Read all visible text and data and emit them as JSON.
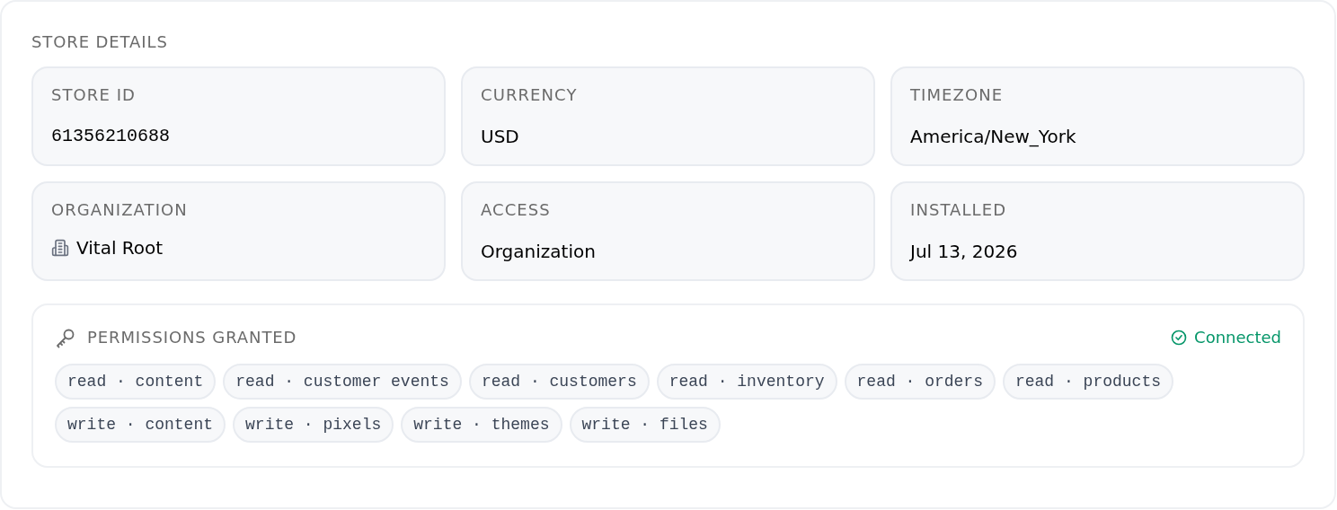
{
  "title": "STORE DETAILS",
  "fields": [
    {
      "label": "STORE ID",
      "value": "61356210688",
      "kind": "mono"
    },
    {
      "label": "CURRENCY",
      "value": "USD",
      "kind": "plain"
    },
    {
      "label": "TIMEZONE",
      "value": "America/New_York",
      "kind": "plain"
    },
    {
      "label": "ORGANIZATION",
      "value": "Vital Root",
      "kind": "organization"
    },
    {
      "label": "ACCESS",
      "value": "Organization",
      "kind": "plain"
    },
    {
      "label": "INSTALLED",
      "value": "Jul 13, 2026",
      "kind": "plain"
    }
  ],
  "permissions": {
    "title": "PERMISSIONS GRANTED",
    "status": {
      "label": "Connected",
      "connected": true
    },
    "scopes": [
      "read · content",
      "read · customer events",
      "read · customers",
      "read · inventory",
      "read · orders",
      "read · products",
      "write · content",
      "write · pixels",
      "write · themes",
      "write · files"
    ]
  }
}
